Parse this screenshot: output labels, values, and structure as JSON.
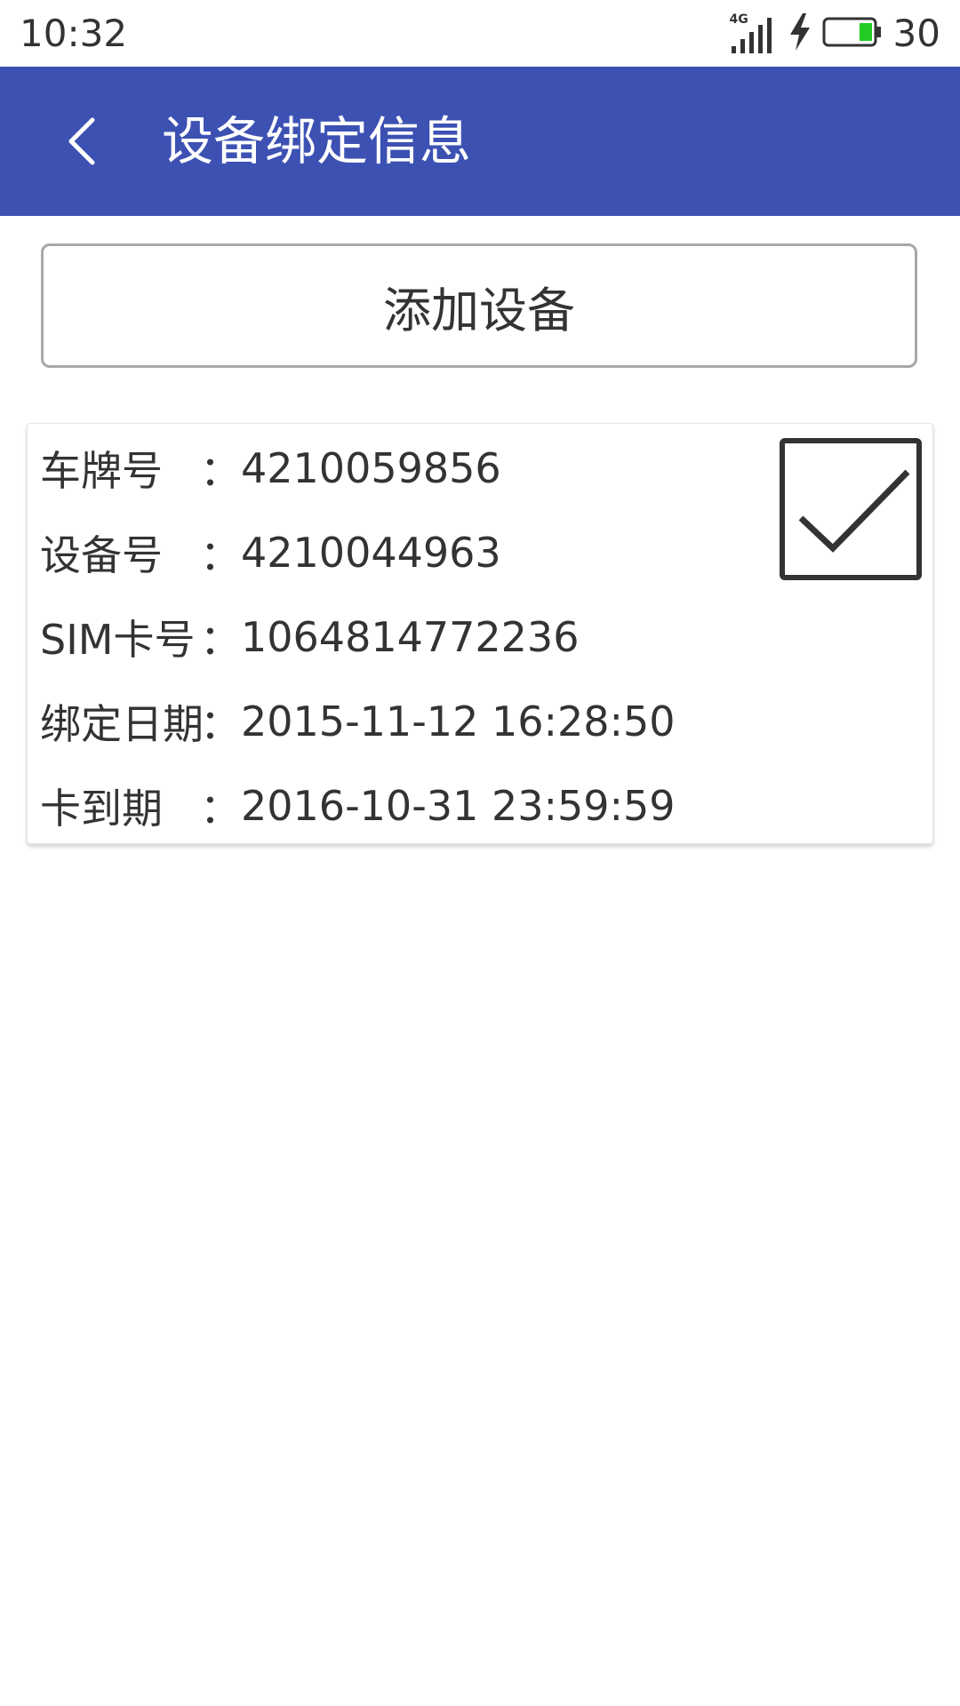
{
  "status_bar": {
    "time": "10:32",
    "network": "4G",
    "battery": "30",
    "icons": [
      "signal-icon",
      "charging-icon",
      "battery-icon"
    ]
  },
  "app_bar": {
    "title": "设备绑定信息",
    "back_icon": "chevron-left-icon"
  },
  "add_button": {
    "label": "添加设备"
  },
  "device": {
    "rows": [
      {
        "label": "车牌号",
        "colon": "：",
        "value": "4210059856"
      },
      {
        "label": "设备号",
        "colon": "：",
        "value": "4210044963"
      },
      {
        "label": "SIM卡号",
        "colon": "：",
        "value": "1064814772236"
      },
      {
        "label": "绑定日期",
        "colon": "：",
        "value": "2015-11-12 16:28:50"
      },
      {
        "label": "卡到期",
        "colon": "：",
        "value": "2016-10-31 23:59:59"
      }
    ],
    "checked": true
  },
  "colors": {
    "app_bar": "#3d51b3",
    "battery_fill": "#22cc22",
    "text": "#333333"
  }
}
